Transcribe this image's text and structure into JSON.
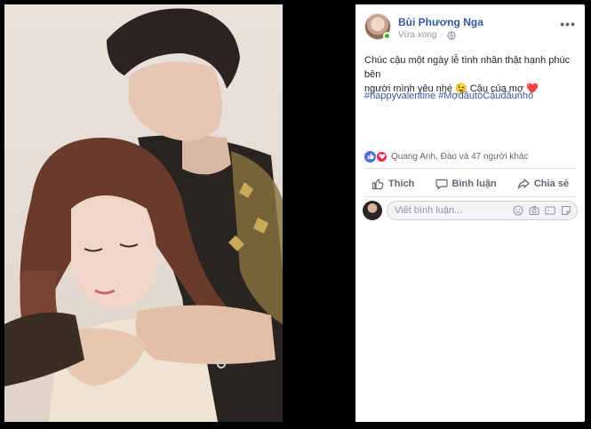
{
  "post": {
    "author": "Bùi Phương Nga",
    "time": "Vừa xong",
    "text_line1": "Chúc cậu một ngày lễ tình nhân thật hạnh phúc bên",
    "text_line2": "người mình yêu nhé 😉 Cậu của mợ ",
    "heart": "❤️",
    "hashtag1": "#happyvalentine",
    "hashtag2": "#MợđầutoCậuđầunhỏ"
  },
  "reactions": {
    "summary": "Quang Anh, Đào và 47 người khác"
  },
  "actions": {
    "like": "Thích",
    "comment": "Bình luận",
    "share": "Chia sẻ"
  },
  "comment": {
    "placeholder": "Viết bình luận..."
  },
  "icons": [
    "globe-icon",
    "more-icon",
    "like-icon",
    "comment-icon",
    "share-icon",
    "emoji-icon",
    "camera-icon",
    "gif-icon",
    "sticker-icon"
  ],
  "colors": {
    "link": "#365899",
    "like": "#4a6fd8",
    "love": "#f0284a"
  }
}
